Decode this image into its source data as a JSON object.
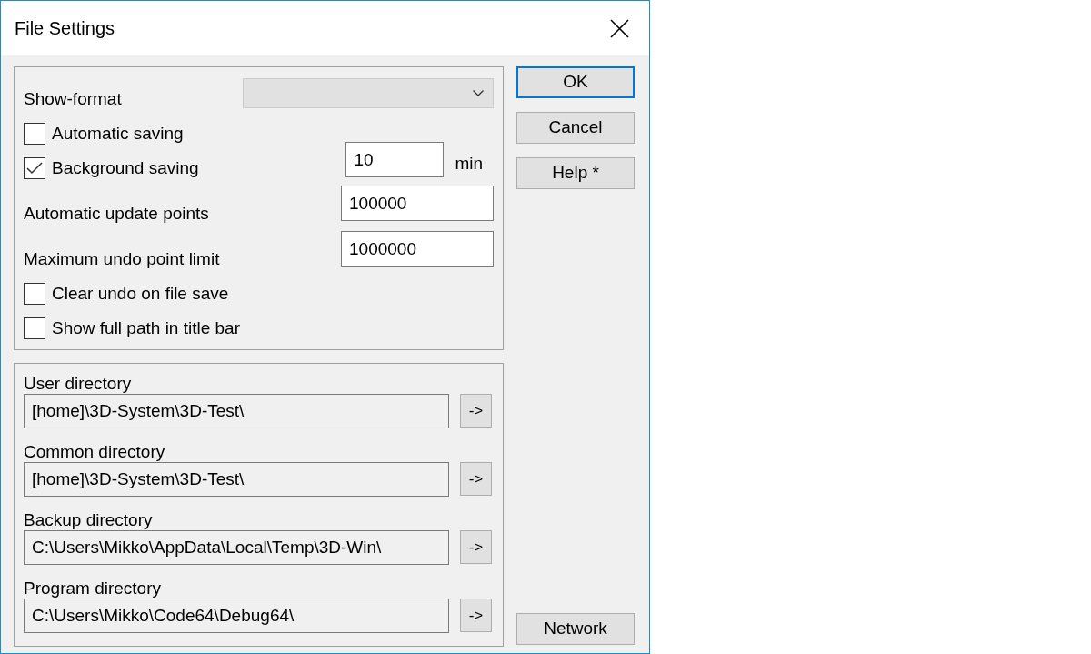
{
  "window": {
    "title": "File Settings"
  },
  "show_format": {
    "label": "Show-format",
    "disabled": true
  },
  "settings": [
    {
      "kind": "checkbox",
      "label": "Automatic saving",
      "checked": false
    },
    {
      "kind": "checkbox",
      "label": "Background saving",
      "checked": true,
      "value": "10",
      "unit": "min"
    },
    {
      "kind": "number",
      "label": "Automatic update points",
      "value": "100000"
    },
    {
      "kind": "number",
      "label": "Maximum undo point limit",
      "value": "1000000"
    },
    {
      "kind": "checkbox",
      "label": "Clear undo on file save",
      "checked": false
    },
    {
      "kind": "checkbox",
      "label": "Show full path in title bar",
      "checked": false
    }
  ],
  "directories": [
    {
      "label": "User directory",
      "value": "[home]\\3D-System\\3D-Test\\",
      "button": "->"
    },
    {
      "label": "Common directory",
      "value": "[home]\\3D-System\\3D-Test\\",
      "button": "->"
    },
    {
      "label": "Backup directory",
      "value": "C:\\Users\\Mikko\\AppData\\Local\\Temp\\3D-Win\\",
      "button": "->"
    },
    {
      "label": "Program directory",
      "value": "C:\\Users\\Mikko\\Code64\\Debug64\\",
      "button": "->"
    }
  ],
  "buttons": [
    {
      "label": "OK",
      "default": true
    },
    {
      "label": "Cancel",
      "default": false
    },
    {
      "label": "Help *",
      "default": false
    }
  ],
  "network_button": {
    "label": "Network"
  }
}
